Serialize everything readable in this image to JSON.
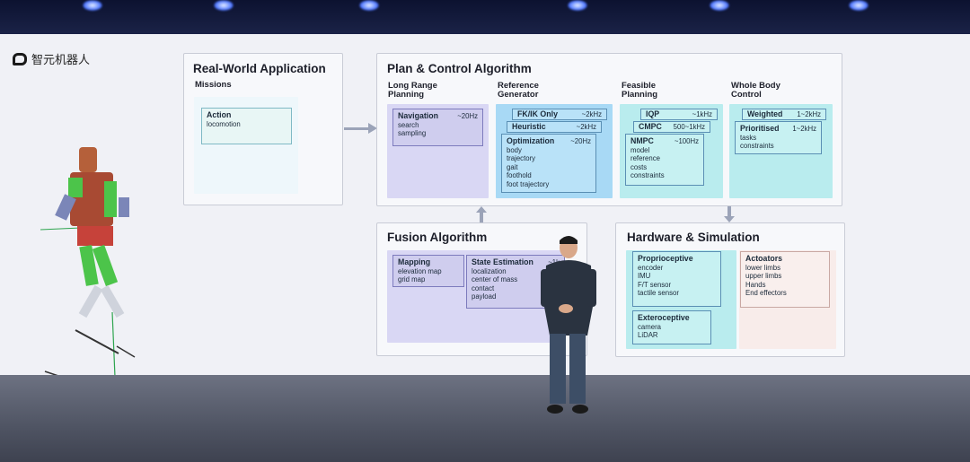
{
  "logo": {
    "text": "智元机器人"
  },
  "real_world": {
    "title": "Real-World Application",
    "subtitle": "Missions",
    "action": {
      "title": "Action",
      "items": [
        "locomotion"
      ]
    }
  },
  "plan": {
    "title": "Plan & Control Algorithm",
    "long_range": {
      "label": "Long Range Planning",
      "card": {
        "title": "Navigation",
        "hz": "~20Hz",
        "items": [
          "search",
          "sampling"
        ]
      }
    },
    "reference": {
      "label": "Reference Generator",
      "fkik": {
        "title": "FK/IK Only",
        "hz": "~2kHz"
      },
      "heuristic": {
        "title": "Heuristic",
        "hz": "~2kHz"
      },
      "optimization": {
        "title": "Optimization",
        "hz": "~20Hz",
        "items": [
          "body",
          "trajectory",
          "gait",
          "foothold",
          "foot trajectory"
        ]
      }
    },
    "feasible": {
      "label": "Feasible Planning",
      "iqp": {
        "title": "IQP",
        "hz": "~1kHz"
      },
      "cmpc": {
        "title": "CMPC",
        "hz": "500~1kHz"
      },
      "nmpc": {
        "title": "NMPC",
        "hz": "~100Hz",
        "items": [
          "model",
          "reference",
          "costs",
          "constraints"
        ]
      }
    },
    "whole_body": {
      "label": "Whole Body Control",
      "weighted": {
        "title": "Weighted",
        "hz": "1~2kHz"
      },
      "prioritised": {
        "title": "Prioritised",
        "hz": "1~2kHz",
        "items": [
          "tasks",
          "constraints"
        ]
      }
    }
  },
  "fusion": {
    "title": "Fusion Algorithm",
    "mapping": {
      "title": "Mapping",
      "items": [
        "elevation map",
        "grid map"
      ]
    },
    "state": {
      "title": "State Estimation",
      "hz": "~1k",
      "items": [
        "localization",
        "center of mass",
        "contact",
        "payload"
      ]
    }
  },
  "hardware": {
    "title": "Hardware & Simulation",
    "proprio": {
      "title": "Proprioceptive",
      "items": [
        "encoder",
        "IMU",
        "F/T sensor",
        "tactile sensor"
      ]
    },
    "extero": {
      "title": "Exteroceptive",
      "items": [
        "camera",
        "LiDAR"
      ]
    },
    "actuators": {
      "title": "Actoators",
      "items": [
        "lower limbs",
        "upper limbs",
        "Hands",
        "End effectors"
      ]
    }
  },
  "colors": {
    "purple": "#d9d7f4",
    "blue": "#a8d9f5",
    "teal": "#b9ecee",
    "pink": "#f8ecea",
    "screen": "#f0f1f6"
  }
}
